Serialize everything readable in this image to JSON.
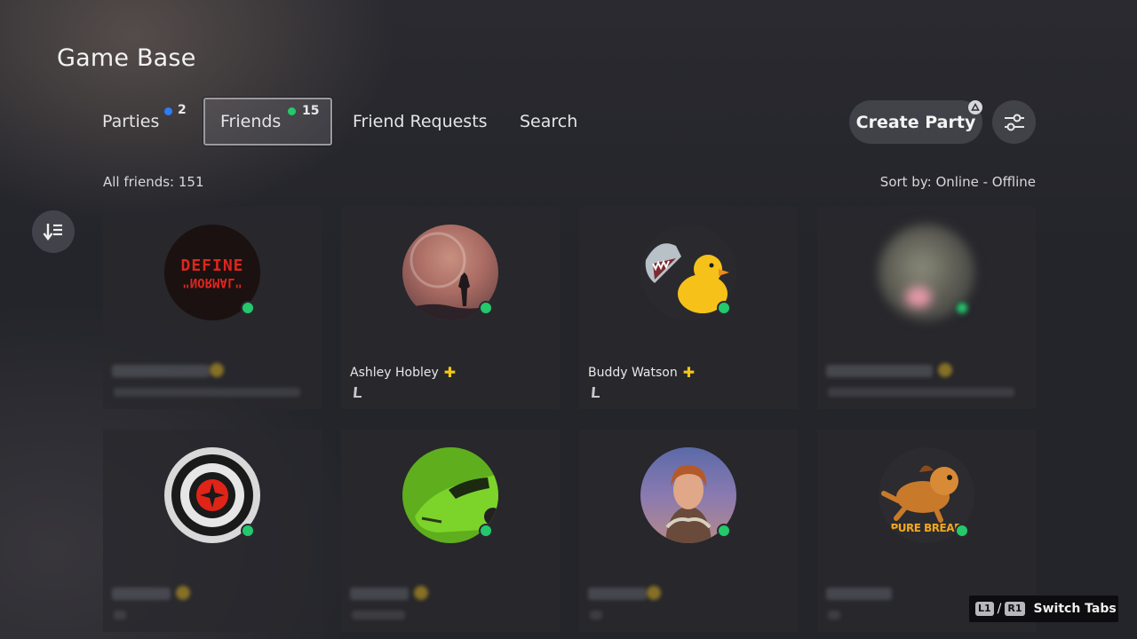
{
  "header": {
    "title": "Game Base"
  },
  "tabs": [
    {
      "label": "Parties",
      "count": "2",
      "dot_color": "#2f7cf6",
      "active": false
    },
    {
      "label": "Friends",
      "count": "15",
      "dot_color": "#23c96b",
      "active": true
    },
    {
      "label": "Friend Requests",
      "active": false
    },
    {
      "label": "Search",
      "active": false
    }
  ],
  "actions": {
    "create_party": "Create Party",
    "triangle_icon": "triangle-icon",
    "filter_icon": "sliders-icon"
  },
  "list_header": {
    "all_friends": "All friends: 151",
    "sort_by": "Sort by: Online - Offline"
  },
  "friends": [
    {
      "name": "",
      "hidden": true,
      "online": true,
      "avatar": "define-normal-avatar",
      "avatar_text_1": "DEFINE",
      "avatar_text_2": "\"NORMAL\""
    },
    {
      "name": "Ashley Hobley",
      "hidden": false,
      "online": true,
      "ps_plus": true,
      "platform_icon": "ps5-console-icon",
      "avatar": "horizon-silhouette-avatar"
    },
    {
      "name": "Buddy Watson",
      "hidden": false,
      "online": true,
      "ps_plus": true,
      "platform_icon": "ps5-console-icon",
      "avatar": "shark-duck-avatar"
    },
    {
      "name": "",
      "hidden": true,
      "online": true,
      "avatar": "blurred-avatar"
    },
    {
      "name": "",
      "hidden": true,
      "online": true,
      "avatar": "target-avatar"
    },
    {
      "name": "",
      "hidden": true,
      "online": true,
      "avatar": "green-car-avatar"
    },
    {
      "name": "",
      "hidden": true,
      "online": true,
      "avatar": "aloy-avatar"
    },
    {
      "name": "",
      "hidden": true,
      "online": true,
      "avatar": "dog-avatar",
      "avatar_text_1": "PURE BREAD"
    }
  ],
  "hint": {
    "key1": "L1",
    "separator": "/",
    "key2": "R1",
    "label": "Switch Tabs"
  },
  "colors": {
    "online": "#23c96b",
    "ps_plus": "#f5c518",
    "background": "#24252b"
  }
}
